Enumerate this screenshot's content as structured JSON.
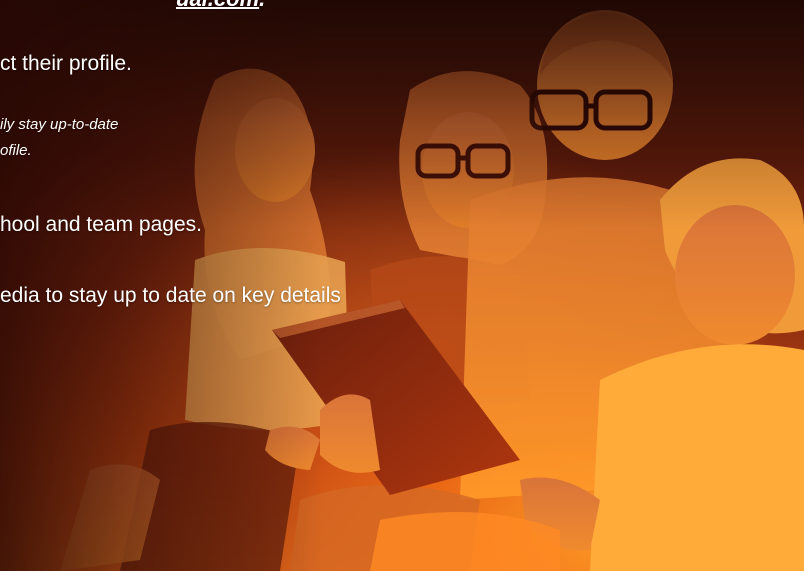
{
  "promo": {
    "link_fragment": "ual.com",
    "link_trailing": ".",
    "line_profile": "ct their profile.",
    "note_line_1": "ily stay up-to-date",
    "note_line_2": "ofile.",
    "line_pages": "hool and team pages.",
    "line_media": "edia to stay up to date on key details"
  },
  "colors": {
    "overlay_dark": "#3a1208",
    "overlay_mid": "#c24712",
    "overlay_bright": "#ffa028",
    "text": "#ffffff"
  },
  "image": {
    "subject": "family-with-tablet-photo"
  }
}
